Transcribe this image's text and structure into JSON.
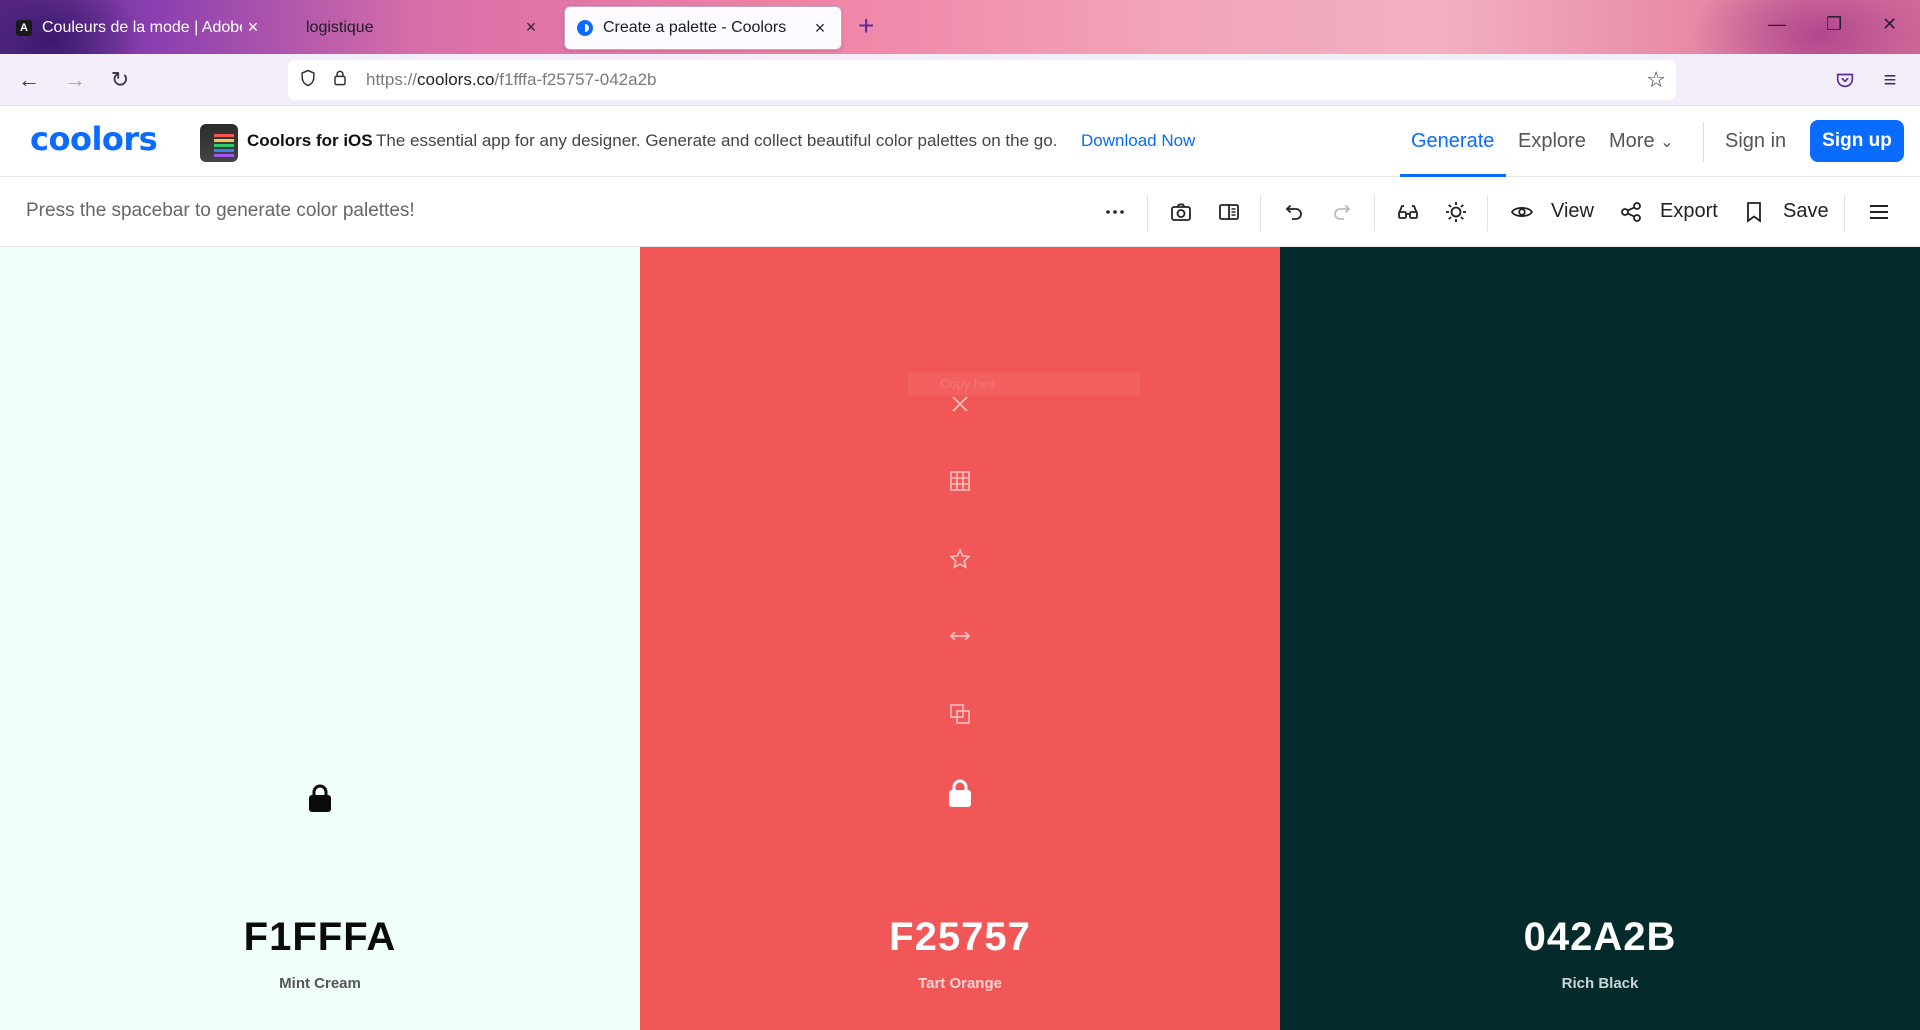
{
  "browser": {
    "tabs": [
      {
        "title": "Couleurs de la mode | Adobe C",
        "favicon": "adobe-icon"
      },
      {
        "title": "logistique",
        "favicon": ""
      },
      {
        "title": "Create a palette - Coolors",
        "favicon": "coolors-icon",
        "active": true
      }
    ],
    "url_scheme": "https://",
    "url_host": "coolors.co",
    "url_path": "/f1fffa-f25757-042a2b"
  },
  "header": {
    "logo": "coolors",
    "promo_title": "Coolors for iOS",
    "promo_desc": "The essential app for any designer. Generate and collect beautiful color palettes on the go.",
    "promo_link": "Download Now",
    "nav": {
      "generate": "Generate",
      "explore": "Explore",
      "more": "More",
      "signin": "Sign in",
      "signup": "Sign up"
    },
    "accent": "#0a6cff"
  },
  "toolbar": {
    "hint": "Press the spacebar to generate color palettes!",
    "view": "View",
    "export": "Export",
    "save": "Save"
  },
  "palette": {
    "colors": [
      {
        "hex": "F1FFFA",
        "name": "Mint Cream",
        "bg": "#f1fffa",
        "fg": "#0b0b0b",
        "sub": "#555555"
      },
      {
        "hex": "F25757",
        "name": "Tart Orange",
        "bg": "#f25757",
        "fg": "#ffffff",
        "sub": "#fbd4d4"
      },
      {
        "hex": "042A2B",
        "name": "Rich Black",
        "bg": "#042a2b",
        "fg": "#ffffff",
        "sub": "#c9d6d6"
      }
    ],
    "hover_tooltip": "Copy hex"
  }
}
